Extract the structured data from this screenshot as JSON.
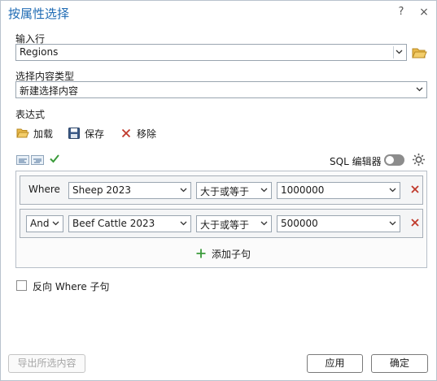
{
  "dialog": {
    "title": "按属性选择",
    "help": "?",
    "close": "×"
  },
  "input_rows": {
    "label": "输入行",
    "value": "Regions"
  },
  "selection_type": {
    "label": "选择内容类型",
    "value": "新建选择内容"
  },
  "expression": {
    "label": "表达式",
    "load_label": "加载",
    "save_label": "保存",
    "remove_label": "移除",
    "sql_label": "SQL 编辑器"
  },
  "clauses": [
    {
      "connector": "Where",
      "field": "Sheep 2023",
      "operator": "大于或等于",
      "value": "1000000"
    },
    {
      "connector": "And",
      "field": "Beef Cattle 2023",
      "operator": "大于或等于",
      "value": "500000"
    }
  ],
  "add_clause_label": "添加子句",
  "invert_where_label": "反向 Where 子句",
  "buttons": {
    "export": "导出所选内容",
    "apply": "应用",
    "ok": "确定"
  },
  "colors": {
    "title": "#1f6bb4",
    "remove_icon": "#c0392b",
    "add_icon": "#3a9b3a",
    "check_icon": "#3a9b3a",
    "folder_icon": "#d9a62e"
  }
}
